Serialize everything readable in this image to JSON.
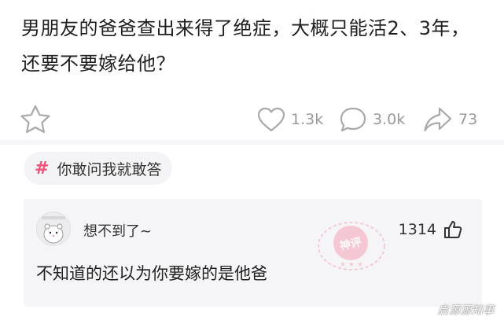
{
  "post": {
    "text": "男朋友的爸爸查出来得了绝症，大概只能活2、3年，还要不要嫁给他？",
    "like_count": "1.3k",
    "comment_count": "3.0k",
    "share_count": "73"
  },
  "topic": {
    "label": "你敢问我就敢答"
  },
  "comment": {
    "username": "想不到了~",
    "like_count": "1314",
    "text": "不知道的还以为你要嫁的是他爸",
    "stamp_text": "神评"
  },
  "watermark": "启源源知事",
  "colors": {
    "accent": "#f0527a",
    "icon_gray": "#9a9a9a",
    "card_bg": "#f5f5f7"
  },
  "icons": {
    "favorite": "star-icon",
    "like": "heart-icon",
    "comment": "speech-bubble-icon",
    "share": "share-arrow-icon",
    "topic": "hash-icon",
    "comment_like": "thumbs-up-icon"
  }
}
